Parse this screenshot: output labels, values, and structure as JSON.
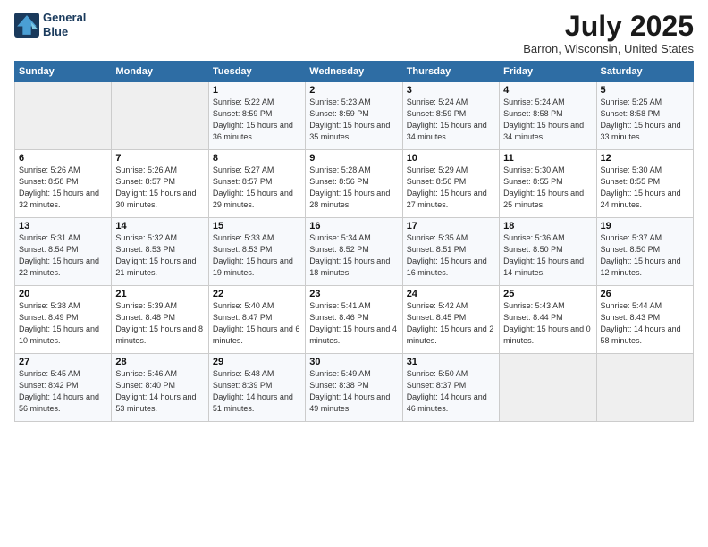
{
  "header": {
    "logo_line1": "General",
    "logo_line2": "Blue",
    "month": "July 2025",
    "location": "Barron, Wisconsin, United States"
  },
  "weekdays": [
    "Sunday",
    "Monday",
    "Tuesday",
    "Wednesday",
    "Thursday",
    "Friday",
    "Saturday"
  ],
  "weeks": [
    [
      {
        "day": "",
        "sunrise": "",
        "sunset": "",
        "daylight": "",
        "empty": true
      },
      {
        "day": "",
        "sunrise": "",
        "sunset": "",
        "daylight": "",
        "empty": true
      },
      {
        "day": "1",
        "sunrise": "Sunrise: 5:22 AM",
        "sunset": "Sunset: 8:59 PM",
        "daylight": "Daylight: 15 hours and 36 minutes."
      },
      {
        "day": "2",
        "sunrise": "Sunrise: 5:23 AM",
        "sunset": "Sunset: 8:59 PM",
        "daylight": "Daylight: 15 hours and 35 minutes."
      },
      {
        "day": "3",
        "sunrise": "Sunrise: 5:24 AM",
        "sunset": "Sunset: 8:59 PM",
        "daylight": "Daylight: 15 hours and 34 minutes."
      },
      {
        "day": "4",
        "sunrise": "Sunrise: 5:24 AM",
        "sunset": "Sunset: 8:58 PM",
        "daylight": "Daylight: 15 hours and 34 minutes."
      },
      {
        "day": "5",
        "sunrise": "Sunrise: 5:25 AM",
        "sunset": "Sunset: 8:58 PM",
        "daylight": "Daylight: 15 hours and 33 minutes."
      }
    ],
    [
      {
        "day": "6",
        "sunrise": "Sunrise: 5:26 AM",
        "sunset": "Sunset: 8:58 PM",
        "daylight": "Daylight: 15 hours and 32 minutes."
      },
      {
        "day": "7",
        "sunrise": "Sunrise: 5:26 AM",
        "sunset": "Sunset: 8:57 PM",
        "daylight": "Daylight: 15 hours and 30 minutes."
      },
      {
        "day": "8",
        "sunrise": "Sunrise: 5:27 AM",
        "sunset": "Sunset: 8:57 PM",
        "daylight": "Daylight: 15 hours and 29 minutes."
      },
      {
        "day": "9",
        "sunrise": "Sunrise: 5:28 AM",
        "sunset": "Sunset: 8:56 PM",
        "daylight": "Daylight: 15 hours and 28 minutes."
      },
      {
        "day": "10",
        "sunrise": "Sunrise: 5:29 AM",
        "sunset": "Sunset: 8:56 PM",
        "daylight": "Daylight: 15 hours and 27 minutes."
      },
      {
        "day": "11",
        "sunrise": "Sunrise: 5:30 AM",
        "sunset": "Sunset: 8:55 PM",
        "daylight": "Daylight: 15 hours and 25 minutes."
      },
      {
        "day": "12",
        "sunrise": "Sunrise: 5:30 AM",
        "sunset": "Sunset: 8:55 PM",
        "daylight": "Daylight: 15 hours and 24 minutes."
      }
    ],
    [
      {
        "day": "13",
        "sunrise": "Sunrise: 5:31 AM",
        "sunset": "Sunset: 8:54 PM",
        "daylight": "Daylight: 15 hours and 22 minutes."
      },
      {
        "day": "14",
        "sunrise": "Sunrise: 5:32 AM",
        "sunset": "Sunset: 8:53 PM",
        "daylight": "Daylight: 15 hours and 21 minutes."
      },
      {
        "day": "15",
        "sunrise": "Sunrise: 5:33 AM",
        "sunset": "Sunset: 8:53 PM",
        "daylight": "Daylight: 15 hours and 19 minutes."
      },
      {
        "day": "16",
        "sunrise": "Sunrise: 5:34 AM",
        "sunset": "Sunset: 8:52 PM",
        "daylight": "Daylight: 15 hours and 18 minutes."
      },
      {
        "day": "17",
        "sunrise": "Sunrise: 5:35 AM",
        "sunset": "Sunset: 8:51 PM",
        "daylight": "Daylight: 15 hours and 16 minutes."
      },
      {
        "day": "18",
        "sunrise": "Sunrise: 5:36 AM",
        "sunset": "Sunset: 8:50 PM",
        "daylight": "Daylight: 15 hours and 14 minutes."
      },
      {
        "day": "19",
        "sunrise": "Sunrise: 5:37 AM",
        "sunset": "Sunset: 8:50 PM",
        "daylight": "Daylight: 15 hours and 12 minutes."
      }
    ],
    [
      {
        "day": "20",
        "sunrise": "Sunrise: 5:38 AM",
        "sunset": "Sunset: 8:49 PM",
        "daylight": "Daylight: 15 hours and 10 minutes."
      },
      {
        "day": "21",
        "sunrise": "Sunrise: 5:39 AM",
        "sunset": "Sunset: 8:48 PM",
        "daylight": "Daylight: 15 hours and 8 minutes."
      },
      {
        "day": "22",
        "sunrise": "Sunrise: 5:40 AM",
        "sunset": "Sunset: 8:47 PM",
        "daylight": "Daylight: 15 hours and 6 minutes."
      },
      {
        "day": "23",
        "sunrise": "Sunrise: 5:41 AM",
        "sunset": "Sunset: 8:46 PM",
        "daylight": "Daylight: 15 hours and 4 minutes."
      },
      {
        "day": "24",
        "sunrise": "Sunrise: 5:42 AM",
        "sunset": "Sunset: 8:45 PM",
        "daylight": "Daylight: 15 hours and 2 minutes."
      },
      {
        "day": "25",
        "sunrise": "Sunrise: 5:43 AM",
        "sunset": "Sunset: 8:44 PM",
        "daylight": "Daylight: 15 hours and 0 minutes."
      },
      {
        "day": "26",
        "sunrise": "Sunrise: 5:44 AM",
        "sunset": "Sunset: 8:43 PM",
        "daylight": "Daylight: 14 hours and 58 minutes."
      }
    ],
    [
      {
        "day": "27",
        "sunrise": "Sunrise: 5:45 AM",
        "sunset": "Sunset: 8:42 PM",
        "daylight": "Daylight: 14 hours and 56 minutes."
      },
      {
        "day": "28",
        "sunrise": "Sunrise: 5:46 AM",
        "sunset": "Sunset: 8:40 PM",
        "daylight": "Daylight: 14 hours and 53 minutes."
      },
      {
        "day": "29",
        "sunrise": "Sunrise: 5:48 AM",
        "sunset": "Sunset: 8:39 PM",
        "daylight": "Daylight: 14 hours and 51 minutes."
      },
      {
        "day": "30",
        "sunrise": "Sunrise: 5:49 AM",
        "sunset": "Sunset: 8:38 PM",
        "daylight": "Daylight: 14 hours and 49 minutes."
      },
      {
        "day": "31",
        "sunrise": "Sunrise: 5:50 AM",
        "sunset": "Sunset: 8:37 PM",
        "daylight": "Daylight: 14 hours and 46 minutes."
      },
      {
        "day": "",
        "sunrise": "",
        "sunset": "",
        "daylight": "",
        "empty": true
      },
      {
        "day": "",
        "sunrise": "",
        "sunset": "",
        "daylight": "",
        "empty": true
      }
    ]
  ]
}
